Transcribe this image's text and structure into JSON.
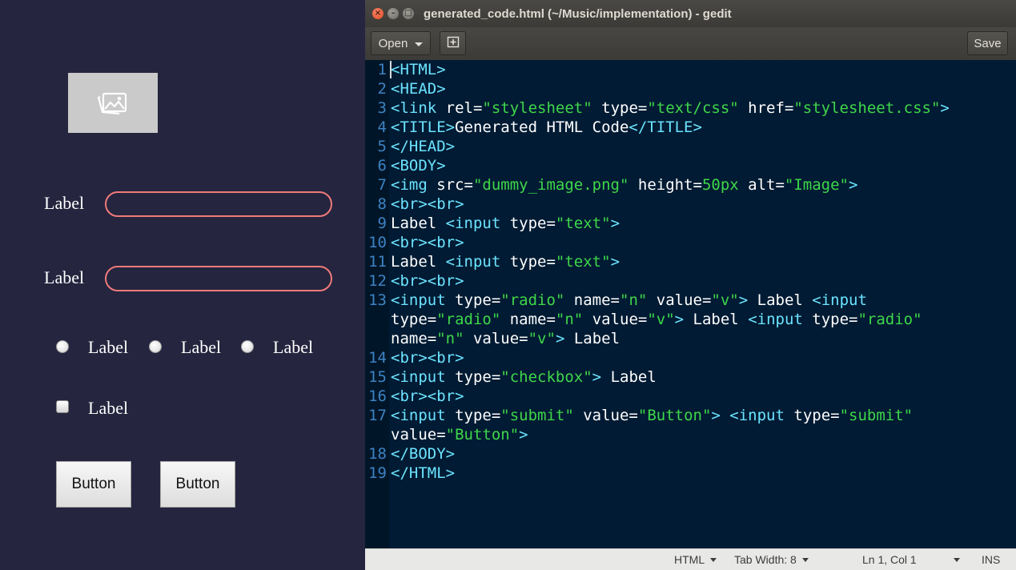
{
  "preview": {
    "image_icon": "image-placeholder-icon",
    "label1": "Label",
    "label2": "Label",
    "radio_labels": [
      "Label",
      "Label",
      "Label"
    ],
    "checkbox_label": "Label",
    "button1": "Button",
    "button2": "Button"
  },
  "window": {
    "title": "generated_code.html (~/Music/implementation) - gedit",
    "close_glyph": "×",
    "min_glyph": "–",
    "max_glyph": "□"
  },
  "toolbar": {
    "open_label": "Open",
    "new_tab_icon": "new-tab-icon",
    "save_label": "Save"
  },
  "line_numbers": [
    "1",
    "2",
    "3",
    "4",
    "5",
    "6",
    "7",
    "8",
    "9",
    "10",
    "11",
    "12",
    "13",
    "14",
    "15",
    "16",
    "17",
    "18",
    "19"
  ],
  "code_lines": [
    [
      {
        "c": "tag",
        "t": "<HTML>"
      }
    ],
    [
      {
        "c": "tag",
        "t": "<HEAD>"
      }
    ],
    [
      {
        "c": "tag",
        "t": "<link "
      },
      {
        "c": "attr",
        "t": "rel="
      },
      {
        "c": "str",
        "t": "\"stylesheet\""
      },
      {
        "c": "attr",
        "t": " type="
      },
      {
        "c": "str",
        "t": "\"text/css\""
      },
      {
        "c": "attr",
        "t": " href="
      },
      {
        "c": "str",
        "t": "\"stylesheet.css\""
      },
      {
        "c": "tag",
        "t": ">"
      }
    ],
    [
      {
        "c": "tag",
        "t": "<TITLE>"
      },
      {
        "c": "txt",
        "t": "Generated HTML Code"
      },
      {
        "c": "tag",
        "t": "</TITLE>"
      }
    ],
    [
      {
        "c": "tag",
        "t": "</HEAD>"
      }
    ],
    [
      {
        "c": "tag",
        "t": "<BODY>"
      }
    ],
    [
      {
        "c": "tag",
        "t": "<img "
      },
      {
        "c": "attr",
        "t": "src="
      },
      {
        "c": "str",
        "t": "\"dummy_image.png\""
      },
      {
        "c": "attr",
        "t": " height="
      },
      {
        "c": "str",
        "t": "50px"
      },
      {
        "c": "attr",
        "t": " alt="
      },
      {
        "c": "str",
        "t": "\"Image\""
      },
      {
        "c": "tag",
        "t": ">"
      }
    ],
    [
      {
        "c": "tag",
        "t": "<br><br>"
      }
    ],
    [
      {
        "c": "txt",
        "t": "Label "
      },
      {
        "c": "tag",
        "t": "<input "
      },
      {
        "c": "attr",
        "t": "type="
      },
      {
        "c": "str",
        "t": "\"text\""
      },
      {
        "c": "tag",
        "t": ">"
      }
    ],
    [
      {
        "c": "tag",
        "t": "<br><br>"
      }
    ],
    [
      {
        "c": "txt",
        "t": "Label "
      },
      {
        "c": "tag",
        "t": "<input "
      },
      {
        "c": "attr",
        "t": "type="
      },
      {
        "c": "str",
        "t": "\"text\""
      },
      {
        "c": "tag",
        "t": ">"
      }
    ],
    [
      {
        "c": "tag",
        "t": "<br><br>"
      }
    ],
    [
      {
        "c": "tag",
        "t": "<input "
      },
      {
        "c": "attr",
        "t": "type="
      },
      {
        "c": "str",
        "t": "\"radio\""
      },
      {
        "c": "attr",
        "t": " name="
      },
      {
        "c": "str",
        "t": "\"n\""
      },
      {
        "c": "attr",
        "t": " value="
      },
      {
        "c": "str",
        "t": "\"v\""
      },
      {
        "c": "tag",
        "t": ">"
      },
      {
        "c": "txt",
        "t": " Label "
      },
      {
        "c": "tag",
        "t": "<input"
      }
    ],
    [
      {
        "c": "attr",
        "t": "type="
      },
      {
        "c": "str",
        "t": "\"radio\""
      },
      {
        "c": "attr",
        "t": " name="
      },
      {
        "c": "str",
        "t": "\"n\""
      },
      {
        "c": "attr",
        "t": " value="
      },
      {
        "c": "str",
        "t": "\"v\""
      },
      {
        "c": "tag",
        "t": ">"
      },
      {
        "c": "txt",
        "t": " Label "
      },
      {
        "c": "tag",
        "t": "<input "
      },
      {
        "c": "attr",
        "t": "type="
      },
      {
        "c": "str",
        "t": "\"radio\""
      }
    ],
    [
      {
        "c": "attr",
        "t": "name="
      },
      {
        "c": "str",
        "t": "\"n\""
      },
      {
        "c": "attr",
        "t": " value="
      },
      {
        "c": "str",
        "t": "\"v\""
      },
      {
        "c": "tag",
        "t": ">"
      },
      {
        "c": "txt",
        "t": " Label"
      }
    ],
    [
      {
        "c": "tag",
        "t": "<br><br>"
      }
    ],
    [
      {
        "c": "tag",
        "t": "<input "
      },
      {
        "c": "attr",
        "t": "type="
      },
      {
        "c": "str",
        "t": "\"checkbox\""
      },
      {
        "c": "tag",
        "t": ">"
      },
      {
        "c": "txt",
        "t": " Label"
      }
    ],
    [
      {
        "c": "tag",
        "t": "<br><br>"
      }
    ],
    [
      {
        "c": "tag",
        "t": "<input "
      },
      {
        "c": "attr",
        "t": "type="
      },
      {
        "c": "str",
        "t": "\"submit\""
      },
      {
        "c": "attr",
        "t": " value="
      },
      {
        "c": "str",
        "t": "\"Button\""
      },
      {
        "c": "tag",
        "t": ">"
      },
      {
        "c": "txt",
        "t": " "
      },
      {
        "c": "tag",
        "t": "<input "
      },
      {
        "c": "attr",
        "t": "type="
      },
      {
        "c": "str",
        "t": "\"submit\""
      }
    ],
    [
      {
        "c": "attr",
        "t": "value="
      },
      {
        "c": "str",
        "t": "\"Button\""
      },
      {
        "c": "tag",
        "t": ">"
      }
    ],
    [
      {
        "c": "tag",
        "t": "</BODY>"
      }
    ],
    [
      {
        "c": "tag",
        "t": "</HTML>"
      }
    ]
  ],
  "statusbar": {
    "language": "HTML",
    "tab_width": "Tab Width: 8",
    "position": "Ln 1, Col 1",
    "mode": "INS"
  },
  "colors": {
    "editor_bg": "#001b33",
    "tag": "#6ce3ff",
    "string": "#3fd64a",
    "line_number": "#3d82c4",
    "input_border": "#f07a7a"
  }
}
